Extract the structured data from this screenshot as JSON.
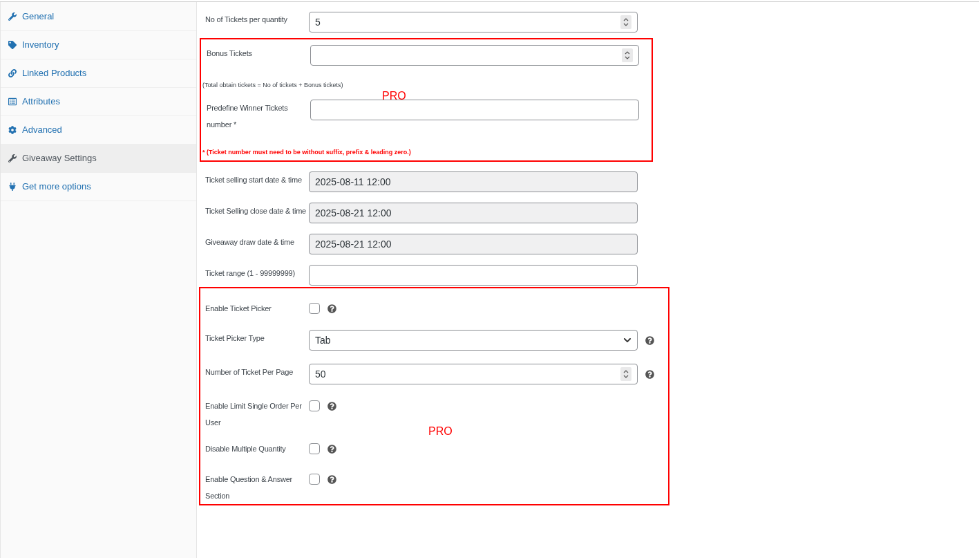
{
  "sidebar": {
    "items": [
      {
        "label": "General",
        "selected": false
      },
      {
        "label": "Inventory",
        "selected": false
      },
      {
        "label": "Linked Products",
        "selected": false
      },
      {
        "label": "Attributes",
        "selected": false
      },
      {
        "label": "Advanced",
        "selected": false
      },
      {
        "label": "Giveaway Settings",
        "selected": true
      },
      {
        "label": "Get more options",
        "selected": false
      }
    ]
  },
  "tickets_per_quantity": {
    "label": "No of Tickets per quantity",
    "value": "5"
  },
  "pro_box_1": {
    "bonus": {
      "label": "Bonus Tickets"
    },
    "note": "(Total obtain tickets = No of tickets + Bonus tickets)",
    "badge": "PRO",
    "winner": {
      "label": "Predefine Winner Tickets number *"
    },
    "warning": "* (Ticket number must need to be without suffix, prefix & leading zero.)"
  },
  "dates": [
    {
      "label": "Ticket selling start date & time",
      "value": "2025-08-11 12:00",
      "disabled": true
    },
    {
      "label": "Ticket Selling close date & time",
      "value": "2025-08-21 12:00",
      "disabled": true
    },
    {
      "label": "Giveaway draw date & time",
      "value": "2025-08-21 12:00",
      "disabled": true
    },
    {
      "label": "Ticket range (1 - 99999999)",
      "disabled": false
    }
  ],
  "pro_box_2": {
    "badge": "PRO",
    "rows": [
      {
        "kind": "checkbox",
        "label": "Enable Ticket Picker",
        "checked": false
      },
      {
        "kind": "select",
        "label": "Ticket Picker Type",
        "value": "Tab"
      },
      {
        "kind": "number",
        "label": "Number of Ticket Per Page",
        "value": "50"
      },
      {
        "kind": "checkbox",
        "label": "Enable Limit Single Order Per User",
        "checked": false
      },
      {
        "kind": "checkbox",
        "label": "Disable Multiple Quantity",
        "checked": false
      },
      {
        "kind": "checkbox",
        "label": "Enable Question & Answer Section",
        "checked": false
      }
    ]
  }
}
